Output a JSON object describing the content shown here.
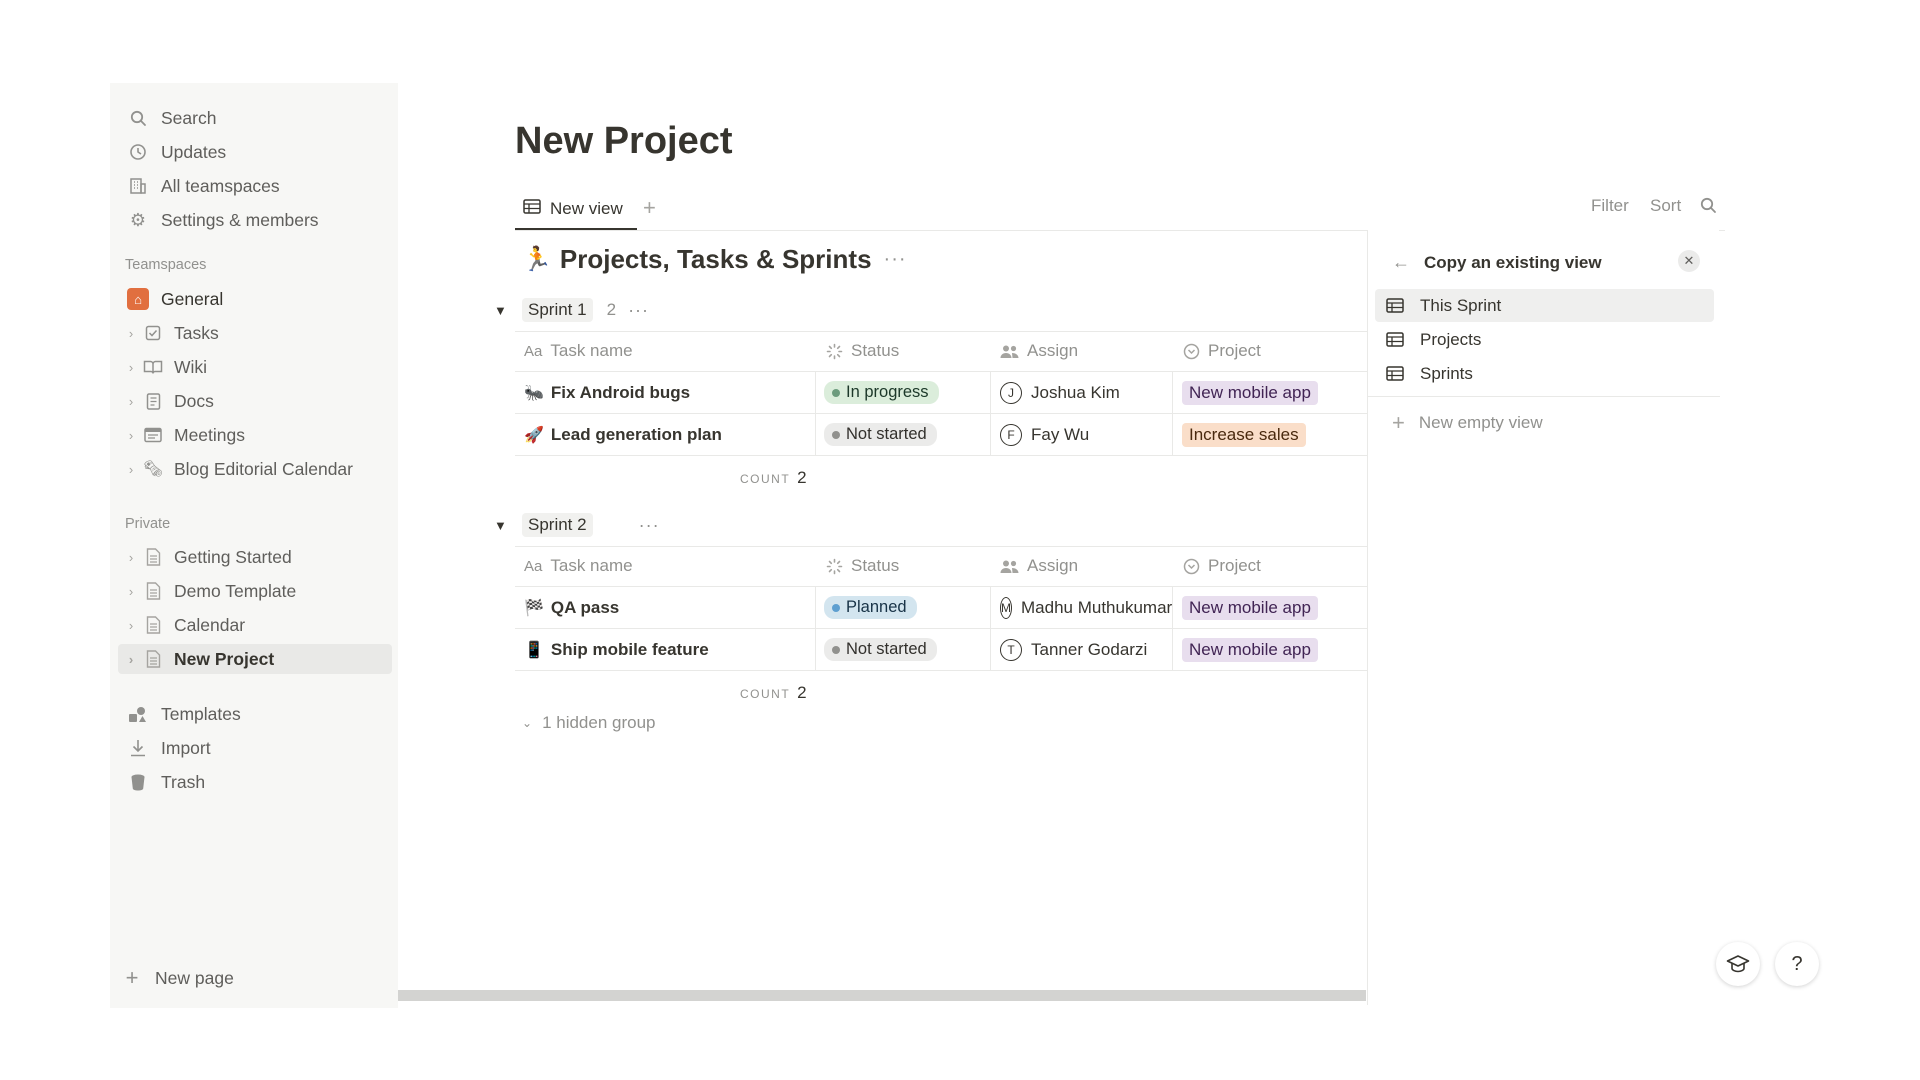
{
  "sidebar": {
    "top_items": [
      {
        "label": "Search",
        "icon": "search-icon"
      },
      {
        "label": "Updates",
        "icon": "clock-icon"
      },
      {
        "label": "All teamspaces",
        "icon": "building-icon"
      },
      {
        "label": "Settings & members",
        "icon": "gear-icon"
      }
    ],
    "teamspaces_label": "Teamspaces",
    "teamspaces": [
      {
        "label": "General",
        "icon": "home-icon"
      },
      {
        "label": "Tasks",
        "icon": "checkbox-icon"
      },
      {
        "label": "Wiki",
        "icon": "book-icon"
      },
      {
        "label": "Docs",
        "icon": "doc-icon"
      },
      {
        "label": "Meetings",
        "icon": "calendar-icon"
      },
      {
        "label": "Blog Editorial Calendar",
        "icon": "newspaper-icon"
      }
    ],
    "private_label": "Private",
    "private": [
      {
        "label": "Getting Started"
      },
      {
        "label": "Demo Template"
      },
      {
        "label": "Calendar"
      },
      {
        "label": "New Project"
      }
    ],
    "bottom_items": [
      {
        "label": "Templates",
        "icon": "shapes-icon"
      },
      {
        "label": "Import",
        "icon": "download-icon"
      },
      {
        "label": "Trash",
        "icon": "trash-icon"
      }
    ],
    "new_page": "New page"
  },
  "page": {
    "title": "New Project",
    "tab_label": "New view",
    "filter": "Filter",
    "sort": "Sort"
  },
  "database": {
    "emoji": "🏃",
    "title": "Projects, Tasks & Sprints",
    "columns": [
      "Task name",
      "Status",
      "Assign",
      "Project"
    ],
    "groups": [
      {
        "name": "Sprint 1",
        "count": "2",
        "rows": [
          {
            "emoji": "🐜",
            "name": "Fix Android bugs",
            "status": "In progress",
            "assign": "Joshua Kim",
            "assign_initial": "J",
            "project": "New mobile app"
          },
          {
            "emoji": "🚀",
            "name": "Lead generation plan",
            "status": "Not started",
            "assign": "Fay Wu",
            "assign_initial": "F",
            "project": "Increase sales"
          }
        ],
        "count_label": "COUNT",
        "count_value": "2"
      },
      {
        "name": "Sprint 2",
        "count": "",
        "rows": [
          {
            "emoji": "🏁",
            "name": "QA pass",
            "status": "Planned",
            "assign": "Madhu Muthukumar",
            "assign_initial": "M",
            "project": "New mobile app"
          },
          {
            "emoji": "📱",
            "name": "Ship mobile feature",
            "status": "Not started",
            "assign": "Tanner Godarzi",
            "assign_initial": "T",
            "project": "New mobile app"
          }
        ],
        "count_label": "COUNT",
        "count_value": "2"
      }
    ],
    "hidden_group": "1 hidden group"
  },
  "panel": {
    "title": "Copy an existing view",
    "views": [
      "This Sprint",
      "Projects",
      "Sprints"
    ],
    "new_empty": "New empty view"
  },
  "colors": {
    "in_progress_bg": "#dbeddb",
    "in_progress_dot": "#6c9b7d",
    "not_started_bg": "#ebebea",
    "not_started_dot": "#91918e",
    "planned_bg": "#d3e5ef",
    "planned_dot": "#5e9fd0",
    "purple_tag_bg": "#e8deee",
    "purple_tag_fg": "#412454",
    "orange_tag_bg": "#fadec9",
    "orange_tag_fg": "#49290e",
    "home_accent": "#e16f3f"
  }
}
